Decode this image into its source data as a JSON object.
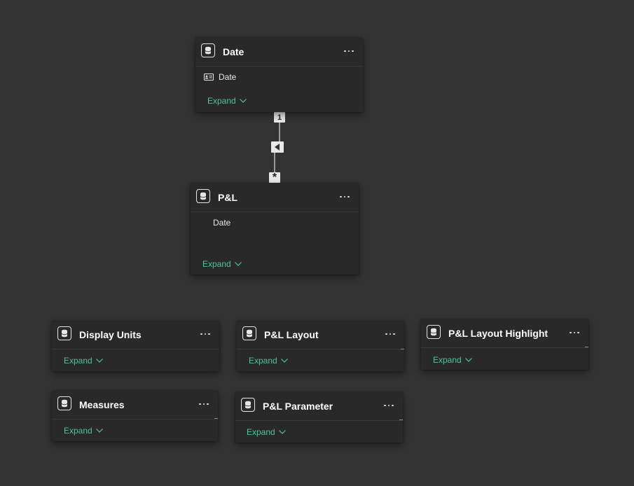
{
  "tables": {
    "date": {
      "title": "Date",
      "fields": [
        "Date"
      ],
      "expand": "Expand"
    },
    "pl": {
      "title": "P&L",
      "fields": [
        "Date"
      ],
      "expand": "Expand"
    },
    "display_units": {
      "title": "Display Units",
      "expand": "Expand"
    },
    "pl_layout": {
      "title": "P&L Layout",
      "expand": "Expand"
    },
    "pl_layout_highlight": {
      "title": "P&L Layout Highlight",
      "expand": "Expand"
    },
    "measures": {
      "title": "Measures",
      "expand": "Expand"
    },
    "pl_parameter": {
      "title": "P&L Parameter",
      "expand": "Expand"
    }
  },
  "relationship": {
    "from_cardinality": "1",
    "to_cardinality": "*"
  },
  "icons": {
    "table": "table-icon",
    "more": "more-options-icon",
    "field": "key-field-icon",
    "expand": "chevron-down-icon",
    "direction": "filter-direction-icon"
  },
  "colors": {
    "background": "#333333",
    "card": "#292929",
    "accent": "#4fc39a",
    "text": "#ffffff"
  }
}
